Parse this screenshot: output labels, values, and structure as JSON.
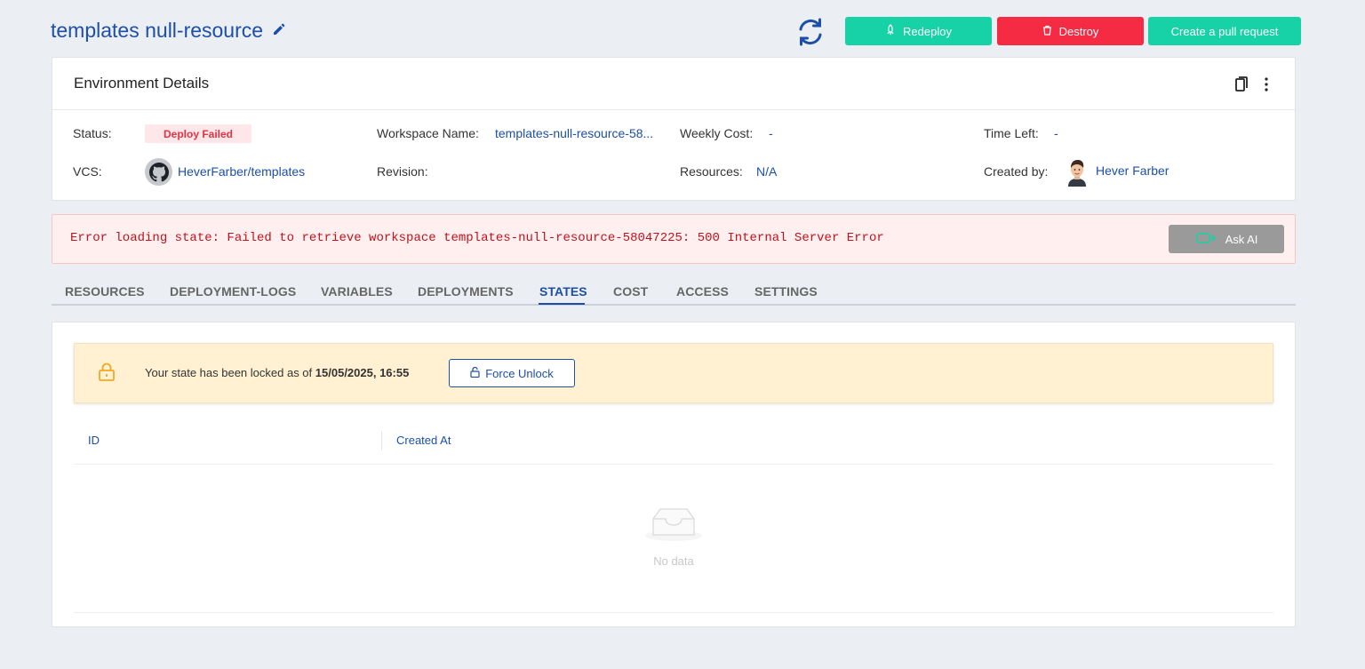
{
  "header": {
    "title": "templates null-resource",
    "buttons": {
      "redeploy": "Redeploy",
      "destroy": "Destroy",
      "pull_request": "Create a pull request"
    }
  },
  "environment": {
    "heading": "Environment Details",
    "fields": {
      "status_label": "Status:",
      "status_value": "Deploy Failed",
      "workspace_label": "Workspace Name:",
      "workspace_value": "templates-null-resource-58...",
      "weekly_cost_label": "Weekly Cost:",
      "weekly_cost_value": "-",
      "time_left_label": "Time Left:",
      "time_left_value": "-",
      "vcs_label": "VCS:",
      "vcs_value": "HeverFarber/templates",
      "revision_label": "Revision:",
      "resources_label": "Resources:",
      "resources_value": "N/A",
      "created_by_label": "Created by:",
      "created_by_value": "Hever Farber"
    }
  },
  "error": {
    "message": "Error loading state: Failed to retrieve workspace templates-null-resource-58047225: 500 Internal Server Error",
    "ask_ai": "Ask AI"
  },
  "tabs": [
    "RESOURCES",
    "DEPLOYMENT-LOGS",
    "VARIABLES",
    "DEPLOYMENTS",
    "STATES",
    "COST",
    "ACCESS",
    "SETTINGS"
  ],
  "active_tab": "STATES",
  "lock": {
    "text": "Your state has been locked as of",
    "timestamp": "15/05/2025, 16:55",
    "button": "Force Unlock"
  },
  "table": {
    "columns": [
      "ID",
      "Created At"
    ],
    "empty_text": "No data"
  },
  "colors": {
    "primary": "#1d4fa8",
    "accent_green": "#17d2a6",
    "danger": "#f52a43",
    "lock_banner": "#fff1d1",
    "error_bg": "#fff0ef"
  }
}
